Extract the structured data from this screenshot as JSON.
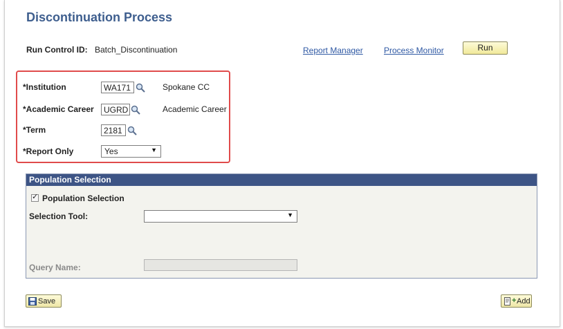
{
  "page": {
    "title": "Discontinuation Process",
    "run_control_label": "Run Control ID:",
    "run_control_value": "Batch_Discontinuation"
  },
  "links": {
    "report_manager": "Report Manager",
    "process_monitor": "Process Monitor"
  },
  "buttons": {
    "run": "Run",
    "save": "Save",
    "add": "Add"
  },
  "form": {
    "institution": {
      "label": "*Institution",
      "value": "WA171",
      "description": "Spokane CC"
    },
    "academic_career": {
      "label": "*Academic Career",
      "value": "UGRD",
      "description": "Academic Career"
    },
    "term": {
      "label": "*Term",
      "value": "2181"
    },
    "report_only": {
      "label": "*Report Only",
      "value": "Yes"
    }
  },
  "population": {
    "header": "Population Selection",
    "checkbox_label": "Population Selection",
    "checkbox_checked": true,
    "selection_tool_label": "Selection Tool:",
    "selection_tool_value": "",
    "query_name_label": "Query Name:",
    "query_name_value": ""
  },
  "colors": {
    "title": "#3e5e8e",
    "link": "#2e58a3",
    "highlight": "#e04b4b",
    "section_header": "#3d5485"
  },
  "icons": {
    "lookup": "magnifier-icon",
    "save": "floppy-disk-icon",
    "add": "add-document-icon",
    "dropdown": "triangle-down-icon"
  }
}
